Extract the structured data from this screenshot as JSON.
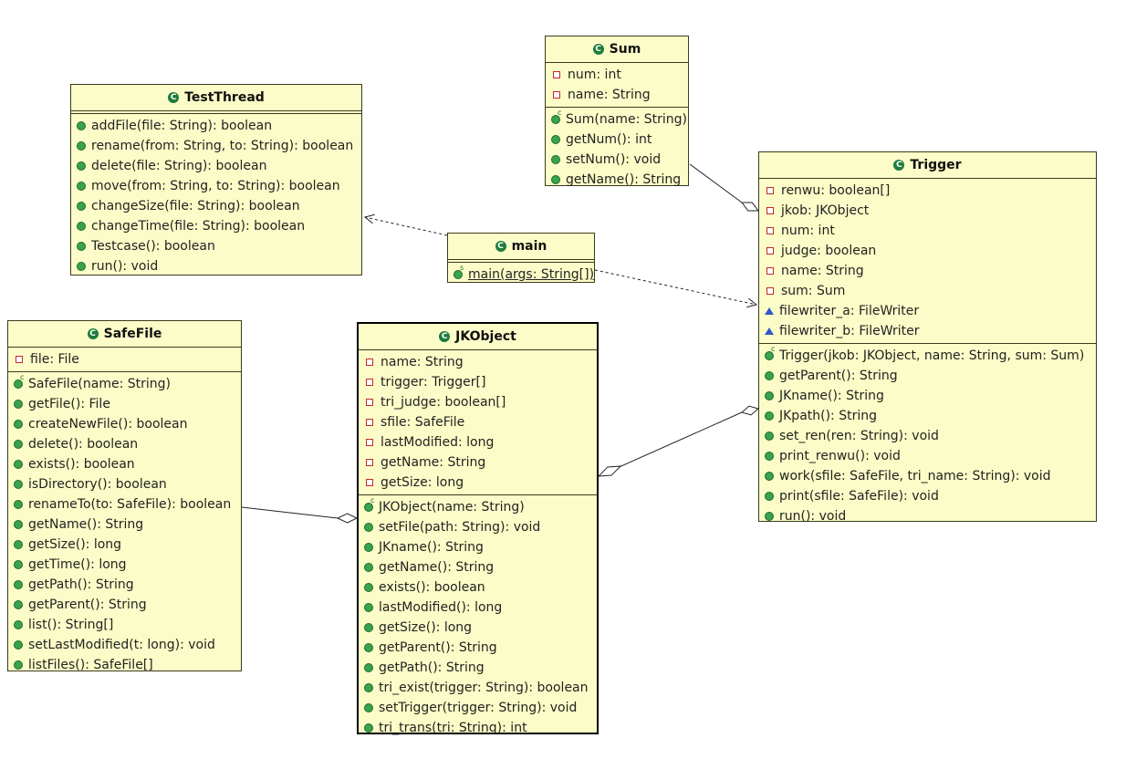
{
  "classes": {
    "TestThread": {
      "name": "TestThread",
      "fields": [],
      "methods": [
        {
          "vis": "public",
          "text": "addFile(file: String): boolean"
        },
        {
          "vis": "public",
          "text": "rename(from: String, to: String): boolean"
        },
        {
          "vis": "public",
          "text": "delete(file: String): boolean"
        },
        {
          "vis": "public",
          "text": "move(from: String, to: String): boolean"
        },
        {
          "vis": "public",
          "text": "changeSize(file: String): boolean"
        },
        {
          "vis": "public",
          "text": "changeTime(file: String): boolean"
        },
        {
          "vis": "public",
          "text": "Testcase(): boolean"
        },
        {
          "vis": "public",
          "text": "run(): void"
        }
      ]
    },
    "Sum": {
      "name": "Sum",
      "fields": [
        {
          "vis": "private",
          "text": "num: int"
        },
        {
          "vis": "private",
          "text": "name: String"
        }
      ],
      "methods": [
        {
          "vis": "ctor",
          "text": "Sum(name: String)"
        },
        {
          "vis": "public",
          "text": "getNum(): int"
        },
        {
          "vis": "public",
          "text": "setNum(): void"
        },
        {
          "vis": "public",
          "text": "getName(): String"
        }
      ]
    },
    "main": {
      "name": "main",
      "fields": [],
      "methods": [
        {
          "vis": "static",
          "text": "main(args: String[])",
          "underline": true
        }
      ]
    },
    "Trigger": {
      "name": "Trigger",
      "fields": [
        {
          "vis": "private",
          "text": "renwu: boolean[]"
        },
        {
          "vis": "private",
          "text": "jkob: JKObject"
        },
        {
          "vis": "private",
          "text": "num: int"
        },
        {
          "vis": "private",
          "text": "judge: boolean"
        },
        {
          "vis": "private",
          "text": "name: String"
        },
        {
          "vis": "private",
          "text": "sum: Sum"
        },
        {
          "vis": "package",
          "text": "filewriter_a: FileWriter"
        },
        {
          "vis": "package",
          "text": "filewriter_b: FileWriter"
        }
      ],
      "methods": [
        {
          "vis": "ctor",
          "text": "Trigger(jkob: JKObject, name: String, sum: Sum)"
        },
        {
          "vis": "public",
          "text": "getParent(): String"
        },
        {
          "vis": "public",
          "text": "JKname(): String"
        },
        {
          "vis": "public",
          "text": "JKpath(): String"
        },
        {
          "vis": "public",
          "text": "set_ren(ren: String): void"
        },
        {
          "vis": "public",
          "text": "print_renwu(): void"
        },
        {
          "vis": "public",
          "text": "work(sfile: SafeFile, tri_name: String): void"
        },
        {
          "vis": "public",
          "text": "print(sfile: SafeFile): void"
        },
        {
          "vis": "public",
          "text": "run(): void"
        }
      ]
    },
    "SafeFile": {
      "name": "SafeFile",
      "fields": [
        {
          "vis": "private",
          "text": "file: File"
        }
      ],
      "methods": [
        {
          "vis": "ctor",
          "text": "SafeFile(name: String)"
        },
        {
          "vis": "public",
          "text": "getFile(): File"
        },
        {
          "vis": "public",
          "text": "createNewFile(): boolean"
        },
        {
          "vis": "public",
          "text": "delete(): boolean"
        },
        {
          "vis": "public",
          "text": "exists(): boolean"
        },
        {
          "vis": "public",
          "text": "isDirectory(): boolean"
        },
        {
          "vis": "public",
          "text": "renameTo(to: SafeFile): boolean"
        },
        {
          "vis": "public",
          "text": "getName(): String"
        },
        {
          "vis": "public",
          "text": "getSize(): long"
        },
        {
          "vis": "public",
          "text": "getTime(): long"
        },
        {
          "vis": "public",
          "text": "getPath(): String"
        },
        {
          "vis": "public",
          "text": "getParent(): String"
        },
        {
          "vis": "public",
          "text": "list(): String[]"
        },
        {
          "vis": "public",
          "text": "setLastModified(t: long): void"
        },
        {
          "vis": "public",
          "text": "listFiles(): SafeFile[]"
        }
      ]
    },
    "JKObject": {
      "name": "JKObject",
      "fields": [
        {
          "vis": "private",
          "text": "name: String"
        },
        {
          "vis": "private",
          "text": "trigger: Trigger[]"
        },
        {
          "vis": "private",
          "text": "tri_judge: boolean[]"
        },
        {
          "vis": "private",
          "text": "sfile: SafeFile"
        },
        {
          "vis": "private",
          "text": "lastModified: long"
        },
        {
          "vis": "private",
          "text": "getName: String"
        },
        {
          "vis": "private",
          "text": "getSize: long"
        }
      ],
      "methods": [
        {
          "vis": "ctor",
          "text": "JKObject(name: String)"
        },
        {
          "vis": "public",
          "text": "setFile(path: String): void"
        },
        {
          "vis": "public",
          "text": "JKname(): String"
        },
        {
          "vis": "public",
          "text": "getName(): String"
        },
        {
          "vis": "public",
          "text": "exists(): boolean"
        },
        {
          "vis": "public",
          "text": "lastModified(): long"
        },
        {
          "vis": "public",
          "text": "getSize(): long"
        },
        {
          "vis": "public",
          "text": "getParent(): String"
        },
        {
          "vis": "public",
          "text": "getPath(): String"
        },
        {
          "vis": "public",
          "text": "tri_exist(trigger: String): boolean"
        },
        {
          "vis": "public",
          "text": "setTrigger(trigger: String): void"
        },
        {
          "vis": "public",
          "text": "tri_trans(tri: String): int"
        }
      ]
    }
  },
  "relations": [
    {
      "type": "dependency",
      "from": "main",
      "to": "TestThread"
    },
    {
      "type": "dependency",
      "from": "main",
      "to": "Trigger"
    },
    {
      "type": "aggregation",
      "whole": "Trigger",
      "part": "Sum"
    },
    {
      "type": "aggregation",
      "whole": "JKObject",
      "part": "Trigger"
    },
    {
      "type": "aggregation",
      "whole": "JKObject",
      "part": "SafeFile"
    }
  ],
  "colors": {
    "class_fill": "#fcfcc8",
    "class_border": "#3b3b1e",
    "public_icon": "#3aa24c",
    "private_icon": "#c02a2a",
    "package_icon": "#2f58c8",
    "class_icon": "#1e7d3c"
  }
}
